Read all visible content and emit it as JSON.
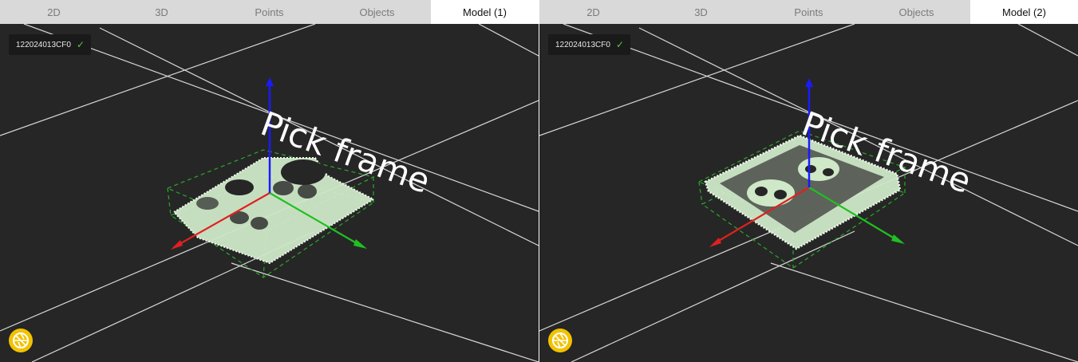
{
  "panes": [
    {
      "tabs": [
        "2D",
        "3D",
        "Points",
        "Objects",
        "Model (1)"
      ],
      "active_tab": 4,
      "serial": "122024013CF0",
      "status_icon": "checkmark-icon",
      "overlay_label": "Pick frame",
      "camera_button_icon": "shutter-icon"
    },
    {
      "tabs": [
        "2D",
        "3D",
        "Points",
        "Objects",
        "Model (2)"
      ],
      "active_tab": 4,
      "serial": "122024013CF0",
      "status_icon": "checkmark-icon",
      "overlay_label": "Pick frame",
      "camera_button_icon": "shutter-icon"
    }
  ],
  "colors": {
    "background": "#262626",
    "grid": "#d8d8d8",
    "axis_x": "#e02020",
    "axis_y": "#20c020",
    "axis_z": "#1a1aff",
    "bbox": "#2aa82a",
    "point_cloud": "#dff3dc",
    "camera_button": "#f2c200",
    "check": "#5fc44a"
  }
}
